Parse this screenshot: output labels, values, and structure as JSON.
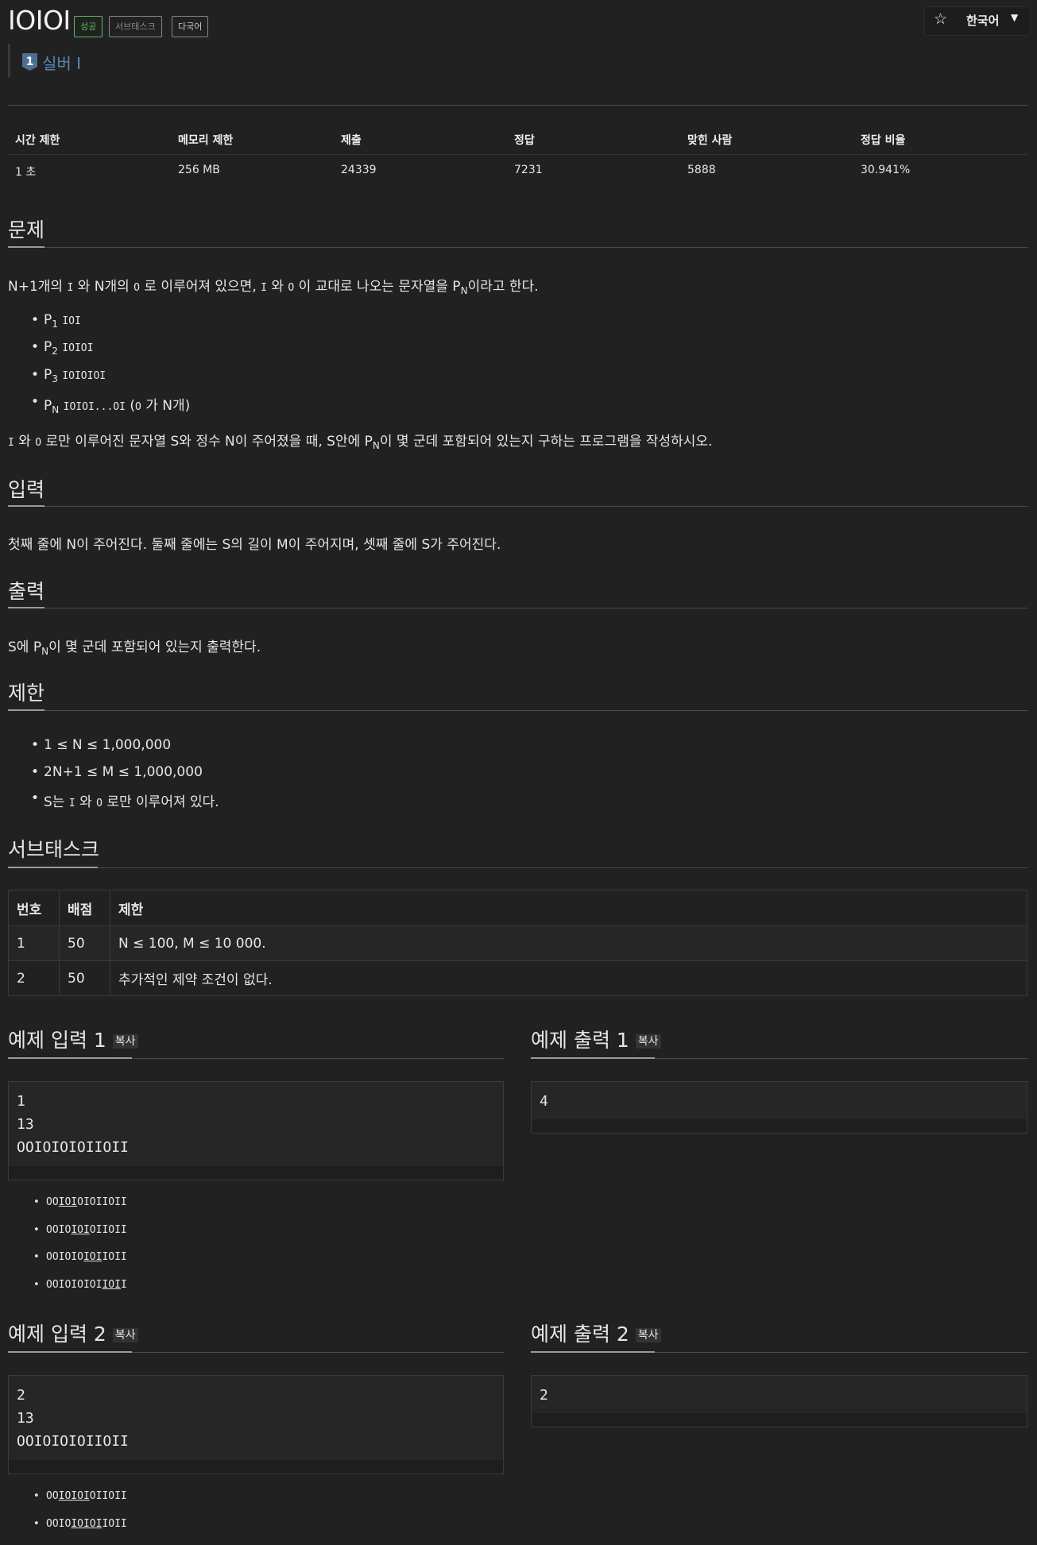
{
  "header": {
    "title": "IOIOI",
    "labels": {
      "success": "성공",
      "subtask": "서브태스크",
      "multilang": "다국어"
    },
    "star_icon": "star-icon",
    "language": "한국어",
    "caret": "▼",
    "tier": {
      "badge": "1",
      "text": "실버 I",
      "color": "#5b87ba"
    }
  },
  "info_table": {
    "headers": [
      "시간 제한",
      "메모리 제한",
      "제출",
      "정답",
      "맞힌 사람",
      "정답 비율"
    ],
    "values": [
      "1 초",
      "256 MB",
      "24339",
      "7231",
      "5888",
      "30.941%"
    ]
  },
  "sections": {
    "problem": {
      "title": "문제",
      "intro_parts": [
        "N+1개의",
        "I",
        "와 N개의",
        "O",
        "로 이루어져 있으면,",
        "I",
        "와",
        "O",
        "이 교대로 나오는 문자열을 P",
        "N",
        "이라고 한다."
      ],
      "items": [
        {
          "p": "P",
          "sub": "1",
          "code": "IOI",
          "suffix": ""
        },
        {
          "p": "P",
          "sub": "2",
          "code": "IOIOI",
          "suffix": ""
        },
        {
          "p": "P",
          "sub": "3",
          "code": "IOIOIOI",
          "suffix": ""
        },
        {
          "p": "P",
          "sub": "N",
          "code": "IOIOI...OI",
          "suffix_a": "(",
          "suffix_code": "O",
          "suffix_b": "가 N개)"
        }
      ],
      "question_parts": [
        "I",
        "와",
        "O",
        "로만 이루어진 문자열 S와 정수 N이 주어졌을 때, S안에 P",
        "N",
        "이 몇 군데 포함되어 있는지 구하는 프로그램을 작성하시오."
      ]
    },
    "input": {
      "title": "입력",
      "text": "첫째 줄에 N이 주어진다. 둘째 줄에는 S의 길이 M이 주어지며, 셋째 줄에 S가 주어진다."
    },
    "output": {
      "title": "출력",
      "parts": [
        "S에 P",
        "N",
        "이 몇 군데 포함되어 있는지 출력한다."
      ]
    },
    "limits": {
      "title": "제한",
      "items": [
        "1 ≤ N ≤ 1,000,000",
        "2N+1 ≤ M ≤ 1,000,000"
      ],
      "item3_parts": [
        "S는",
        "I",
        "와",
        "O",
        "로만 이루어져 있다."
      ]
    },
    "subtask": {
      "title": "서브태스크",
      "headers": [
        "번호",
        "배점",
        "제한"
      ],
      "rows": [
        [
          "1",
          "50",
          "N ≤ 100, M ≤ 10 000."
        ],
        [
          "2",
          "50",
          "추가적인 제약 조건이 없다."
        ]
      ]
    }
  },
  "examples": [
    {
      "input_title": "예제 입력 1",
      "output_title": "예제 출력 1",
      "copy": "복사",
      "input": "1\n13\nOOIOIOIOIIOII",
      "output": "4",
      "explanations": [
        [
          "OO",
          "IOI",
          "OIOIIOII"
        ],
        [
          "OOIO",
          "IOI",
          "OIIOII"
        ],
        [
          "OOIOIO",
          "IOI",
          "IOII"
        ],
        [
          "OOIOIOIOI",
          "IOI",
          "I"
        ]
      ]
    },
    {
      "input_title": "예제 입력 2",
      "output_title": "예제 출력 2",
      "copy": "복사",
      "input": "2\n13\nOOIOIOIOIIOII",
      "output": "2",
      "explanations": [
        [
          "OO",
          "IOIOI",
          "OIIOII"
        ],
        [
          "OOIO",
          "IOIOI",
          "IOII"
        ]
      ]
    }
  ]
}
